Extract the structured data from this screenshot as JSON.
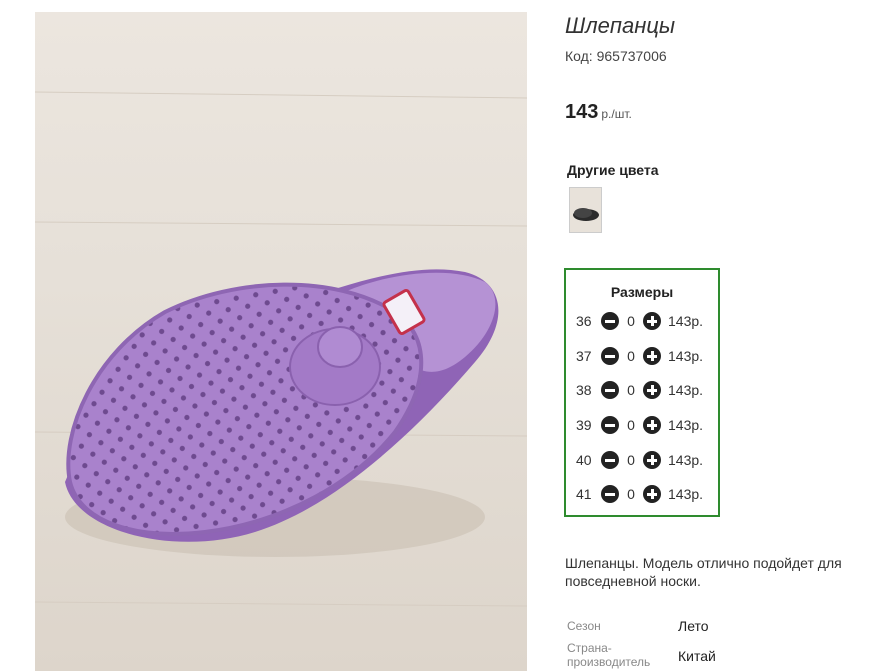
{
  "product": {
    "title": "Шлепанцы",
    "code": "Код: 965737006",
    "price_value": "143",
    "price_unit": "р./шт."
  },
  "other_colors": {
    "title": "Другие цвета",
    "thumbs": [
      {
        "name": "black-slipper-thumb"
      }
    ]
  },
  "sizes": {
    "title": "Размеры",
    "rows": [
      {
        "size": "36",
        "qty": "0",
        "price": "143р."
      },
      {
        "size": "37",
        "qty": "0",
        "price": "143р."
      },
      {
        "size": "38",
        "qty": "0",
        "price": "143р."
      },
      {
        "size": "39",
        "qty": "0",
        "price": "143р."
      },
      {
        "size": "40",
        "qty": "0",
        "price": "143р."
      },
      {
        "size": "41",
        "qty": "0",
        "price": "143р."
      }
    ]
  },
  "description": "Шлепанцы. Модель отлично подойдет для повседневной носки.",
  "properties": [
    {
      "label": "Сезон",
      "value": "Лето"
    },
    {
      "label": "Страна-производитель",
      "value": "Китай"
    }
  ],
  "colors": {
    "accent_border": "#2e8b2e",
    "slipper": "#a77fc8"
  }
}
